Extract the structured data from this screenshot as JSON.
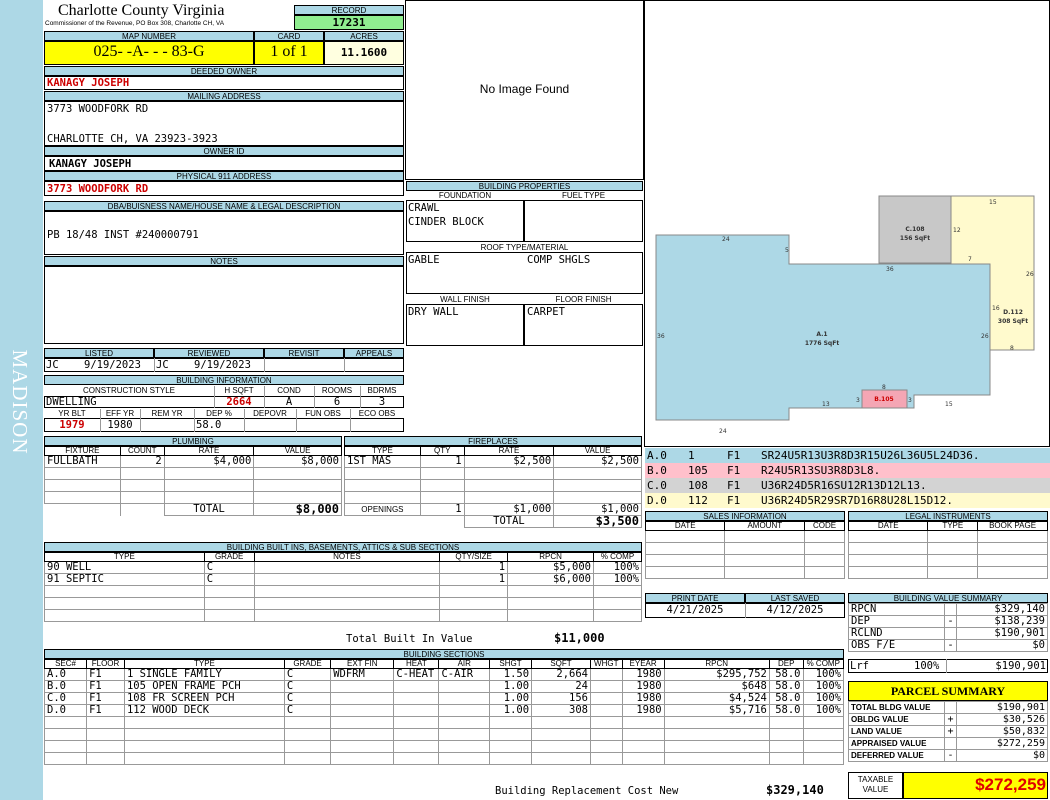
{
  "sidebar": {
    "district": "MADISON"
  },
  "header": {
    "county": "Charlotte County Virginia",
    "address": "Commissioner of the Revenue, PO Box 308, Charlotte CH, VA",
    "record_label": "RECORD",
    "record": "17231"
  },
  "parcel": {
    "map_label": "MAP NUMBER",
    "map_number": "025- -A- - - 83-G",
    "card_label": "CARD",
    "card": "1 of 1",
    "acres_label": "ACRES",
    "acres": "11.1600"
  },
  "owner": {
    "deeded_label": "DEEDED OWNER",
    "deeded_owner": "KANAGY JOSEPH",
    "mailing_label": "MAILING ADDRESS",
    "mailing_line1": "3773 WOODFORK RD",
    "mailing_line2": "CHARLOTTE CH, VA 23923-3923",
    "owner_id_label": "OWNER ID",
    "owner_id": "KANAGY JOSEPH",
    "physical_label": "PHYSICAL 911 ADDRESS",
    "physical": "3773 WOODFORK RD",
    "dba_label": "DBA/BUISNESS NAME/HOUSE NAME & LEGAL DESCRIPTION",
    "dba": "PB 18/48 INST #240000791",
    "notes_label": "NOTES",
    "notes": ""
  },
  "image": {
    "placeholder": "No Image Found"
  },
  "building_properties": {
    "title": "BUILDING PROPERTIES",
    "foundation_label": "FOUNDATION",
    "fuel_label": "FUEL TYPE",
    "foundation1": "CRAWL",
    "foundation2": "CINDER BLOCK",
    "roof_label": "ROOF TYPE/MATERIAL",
    "roof_type": "GABLE",
    "roof_material": "COMP SHGLS",
    "wall_label": "WALL FINISH",
    "floor_label": "FLOOR FINISH",
    "wall": "DRY WALL",
    "floor": "CARPET"
  },
  "review": {
    "listed_label": "LISTED",
    "reviewed_label": "REVIEWED",
    "revisit_label": "REVISIT",
    "appeals_label": "APPEALS",
    "listed_by": "JC",
    "listed_date": "9/19/2023",
    "reviewed_by": "JC",
    "reviewed_date": "9/19/2023"
  },
  "building_info": {
    "title": "BUILDING INFORMATION",
    "style_label": "CONSTRUCTION STYLE",
    "hsqft_label": "H SQFT",
    "cond_label": "COND",
    "rooms_label": "ROOMS",
    "bdrms_label": "BDRMS",
    "style": "DWELLING",
    "hsqft": "2664",
    "cond": "A",
    "rooms": "6",
    "bdrms": "3",
    "yrblt_label": "YR BLT",
    "effyr_label": "EFF YR",
    "remyr_label": "REM YR",
    "dep_label": "DEP %",
    "depovr_label": "DEPOVR",
    "funobs_label": "FUN OBS",
    "ecoobs_label": "ECO OBS",
    "yrblt": "1979",
    "effyr": "1980",
    "remyr": "",
    "dep": "58.0"
  },
  "plumbing": {
    "title": "PLUMBING",
    "headers": [
      "FIXTURE",
      "COUNT",
      "RATE",
      "VALUE"
    ],
    "rows": [
      [
        "FULLBATH",
        "2",
        "$4,000",
        "$8,000"
      ]
    ],
    "total_label": "TOTAL",
    "total": "$8,000"
  },
  "fireplaces": {
    "title": "FIREPLACES",
    "headers": [
      "TYPE",
      "QTY",
      "RATE",
      "VALUE"
    ],
    "rows": [
      [
        "1ST MAS",
        "1",
        "$2,500",
        "$2,500"
      ]
    ],
    "openings_label": "OPENINGS",
    "openings_qty": "1",
    "openings_rate": "$1,000",
    "openings_value": "$1,000",
    "total_label": "TOTAL",
    "total": "$3,500"
  },
  "builtins": {
    "title": "BUILDING BUILT INS, BASEMENTS, ATTICS & SUB SECTIONS",
    "headers": [
      "TYPE",
      "GRADE",
      "NOTES",
      "QTY/SIZE",
      "RPCN",
      "% COMP"
    ],
    "rows": [
      [
        "90 WELL",
        "C",
        "",
        "1",
        "$5,000",
        "100%"
      ],
      [
        "91 SEPTIC",
        "C",
        "",
        "1",
        "$6,000",
        "100%"
      ]
    ],
    "total_label": "Total Built In Value",
    "total": "$11,000"
  },
  "sketch": {
    "areas": [
      {
        "code": "A.1",
        "sqft": "1776 SqFt",
        "color": "#add8e6"
      },
      {
        "code": "B.105",
        "sqft": "",
        "color": "#f4a6b4"
      },
      {
        "code": "C.108",
        "sqft": "156 SqFt",
        "color": "#c8c8c8"
      },
      {
        "code": "D.112",
        "sqft": "308 SqFt",
        "color": "#fffacd"
      }
    ],
    "dims": [
      "24",
      "5",
      "36",
      "36",
      "26",
      "24",
      "13",
      "3",
      "3",
      "15",
      "8",
      "12",
      "7",
      "15",
      "26",
      "16",
      "8"
    ]
  },
  "sketch_legend": [
    {
      "sec": "A.0",
      "num": "1",
      "fl": "F1",
      "desc": "SR24U5R13U3R8D3R15U26L36U5L24D36.",
      "color": "#add8e6"
    },
    {
      "sec": "B.0",
      "num": "105",
      "fl": "F1",
      "desc": "R24U5R13SU3R8D3L8.",
      "color": "#ffc0cb"
    },
    {
      "sec": "C.0",
      "num": "108",
      "fl": "F1",
      "desc": "U36R24D5R16SU12R13D12L13.",
      "color": "#d3d3d3"
    },
    {
      "sec": "D.0",
      "num": "112",
      "fl": "F1",
      "desc": "U36R24D5R29SR7D16R8U28L15D12.",
      "color": "#fffacd"
    }
  ],
  "sales": {
    "title": "SALES INFORMATION",
    "headers": [
      "DATE",
      "AMOUNT",
      "CODE"
    ]
  },
  "legal": {
    "title": "LEGAL INSTRUMENTS",
    "headers": [
      "DATE",
      "TYPE",
      "BOOK PAGE"
    ]
  },
  "dates": {
    "print_label": "PRINT DATE",
    "print_date": "4/21/2025",
    "saved_label": "LAST SAVED",
    "saved_date": "4/12/2025"
  },
  "value_summary": {
    "title": "BUILDING VALUE SUMMARY",
    "rows": [
      [
        "RPCN",
        "",
        "$329,140"
      ],
      [
        "DEP",
        "-",
        "$138,239"
      ],
      [
        "RCLND",
        "",
        "$190,901"
      ],
      [
        "OBS F/E",
        "-",
        "$0"
      ],
      [
        "Lrf",
        "100%",
        "$190,901"
      ]
    ]
  },
  "parcel_summary": {
    "title": "PARCEL SUMMARY",
    "rows": [
      [
        "TOTAL BLDG VALUE",
        "",
        "$190,901"
      ],
      [
        "OBLDG VALUE",
        "+",
        "$30,526"
      ],
      [
        "LAND VALUE",
        "+",
        "$50,832"
      ],
      [
        "APPRAISED VALUE",
        "",
        "$272,259"
      ],
      [
        "DEFERRED VALUE",
        "-",
        "$0"
      ]
    ],
    "taxable_label1": "TAXABLE",
    "taxable_label2": "VALUE",
    "taxable": "$272,259"
  },
  "sections": {
    "title": "BUILDING SECTIONS",
    "headers": [
      "SEC#",
      "FLOOR",
      "TYPE",
      "GRADE",
      "EXT FIN",
      "HEAT",
      "AIR",
      "SHGT",
      "SQFT",
      "WHGT",
      "EYEAR",
      "RPCN",
      "DEP",
      "% COMP"
    ],
    "rows": [
      [
        "A.0",
        "F1",
        "1 SINGLE FAMILY",
        "C",
        "WDFRM",
        "C-HEAT",
        "C-AIR",
        "1.50",
        "2,664",
        "",
        "1980",
        "$295,752",
        "58.0",
        "100%"
      ],
      [
        "B.0",
        "F1",
        "105 OPEN FRAME PCH",
        "C",
        "",
        "",
        "",
        "1.00",
        "24",
        "",
        "1980",
        "$648",
        "58.0",
        "100%"
      ],
      [
        "C.0",
        "F1",
        "108 FR SCREEN PCH",
        "C",
        "",
        "",
        "",
        "1.00",
        "156",
        "",
        "1980",
        "$4,524",
        "58.0",
        "100%"
      ],
      [
        "D.0",
        "F1",
        "112 WOOD DECK",
        "C",
        "",
        "",
        "",
        "1.00",
        "308",
        "",
        "1980",
        "$5,716",
        "58.0",
        "100%"
      ]
    ],
    "total_label": "Building Replacement Cost New",
    "total": "$329,140"
  }
}
